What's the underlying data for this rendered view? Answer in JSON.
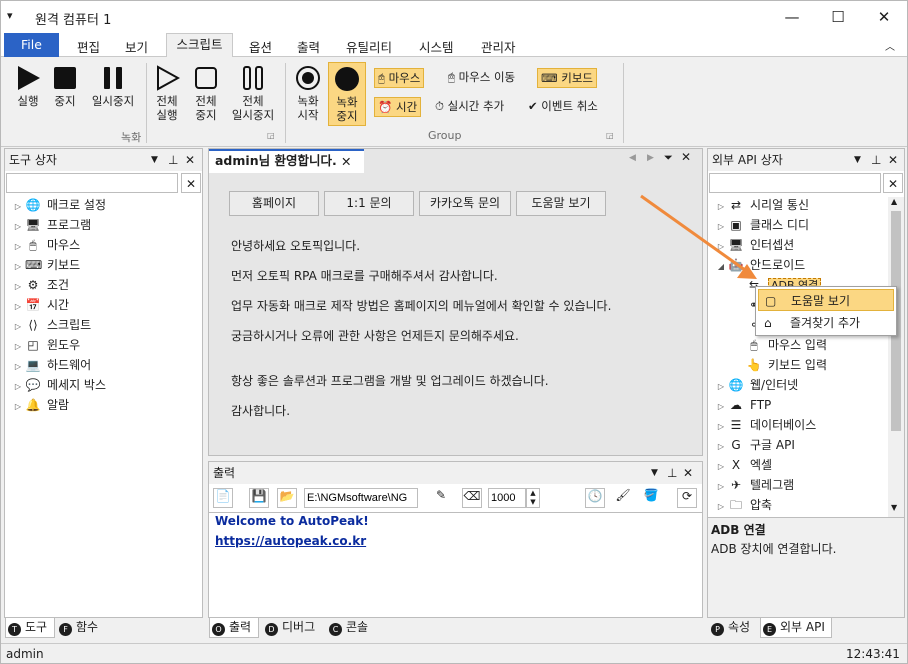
{
  "window": {
    "title": "원격 컴퓨터 1",
    "minimize": "—",
    "maximize": "☐",
    "close": "✕"
  },
  "menu": {
    "file": "File",
    "items": [
      "편집",
      "보기",
      "스크립트",
      "옵션",
      "출력",
      "유틸리티",
      "시스템",
      "관리자"
    ],
    "active_index": 2
  },
  "ribbon": {
    "run": "실행",
    "stop": "중지",
    "pause": "일시중지",
    "all_run_1": "전체",
    "all_run_2": "실행",
    "all_stop_1": "전체",
    "all_stop_2": "중지",
    "all_pause_1": "전체",
    "all_pause_2": "일시중지",
    "rec_start_1": "녹화",
    "rec_start_2": "시작",
    "rec_stop_1": "녹화",
    "rec_stop_2": "중지",
    "mouse": "마우스",
    "mouse_move": "마우스 이동",
    "keyboard": "키보드",
    "time": "시간",
    "realtime_add": "실시간 추가",
    "event_cancel": "이벤트 취소",
    "group_record": "녹화",
    "group_group": "Group"
  },
  "tool_panel": {
    "title": "도구 상자",
    "items": [
      "매크로 설정",
      "프로그램",
      "마우스",
      "키보드",
      "조건",
      "시간",
      "스크립트",
      "윈도우",
      "하드웨어",
      "메세지 박스",
      "알람"
    ],
    "tabs": [
      {
        "badge": "T",
        "label": "도구"
      },
      {
        "badge": "F",
        "label": "함수"
      }
    ]
  },
  "doc": {
    "tab_title": "admin님 환영합니다.",
    "buttons": [
      "홈페이지",
      "1:1 문의",
      "카카오톡 문의",
      "도움말 보기"
    ],
    "lines": [
      "안녕하세요 오토픽입니다.",
      "먼저 오토픽 RPA 매크로를 구매해주셔서 감사합니다.",
      "업무 자동화 매크로 제작 방법은 홈페이지의 메뉴얼에서 확인할 수 있습니다.",
      "궁금하시거나 오류에 관한 사항은 언제든지 문의해주세요.",
      "항상 좋은 솔루션과 프로그램을 개발 및 업그레이드 하겠습니다.",
      "감사합니다."
    ]
  },
  "output": {
    "title": "출력",
    "path": "E:\\NGMsoftware\\NG",
    "delay": "1000",
    "welcome": "Welcome to AutoPeak!",
    "link": "https://autopeak.co.kr",
    "tabs": [
      {
        "badge": "O",
        "label": "출력"
      },
      {
        "badge": "D",
        "label": "디버그"
      },
      {
        "badge": "C",
        "label": "콘솔"
      }
    ]
  },
  "api_panel": {
    "title": "외부 API 상자",
    "items": [
      "시리얼 통신",
      "클래스 디디",
      "인터셉션",
      "안드로이드",
      "ADB 연결",
      "",
      "",
      "마우스 입력",
      "키보드 입력",
      "웹/인터넷",
      "FTP",
      "데이터베이스",
      "구글 API",
      "엑셀",
      "텔레그램",
      "압축"
    ],
    "desc_title": "ADB 연결",
    "desc_text": "ADB 장치에 연결합니다.",
    "tabs": [
      {
        "badge": "P",
        "label": "속성"
      },
      {
        "badge": "E",
        "label": "외부 API"
      }
    ]
  },
  "context_menu": {
    "items": [
      "도움말 보기",
      "즐겨찾기 추가"
    ]
  },
  "status": {
    "user": "admin",
    "time": "12:43:41"
  },
  "colors": {
    "accent": "#2b63c6",
    "highlight": "#fbd783",
    "arrow": "#f08a3c",
    "link": "#0a2b9e"
  }
}
